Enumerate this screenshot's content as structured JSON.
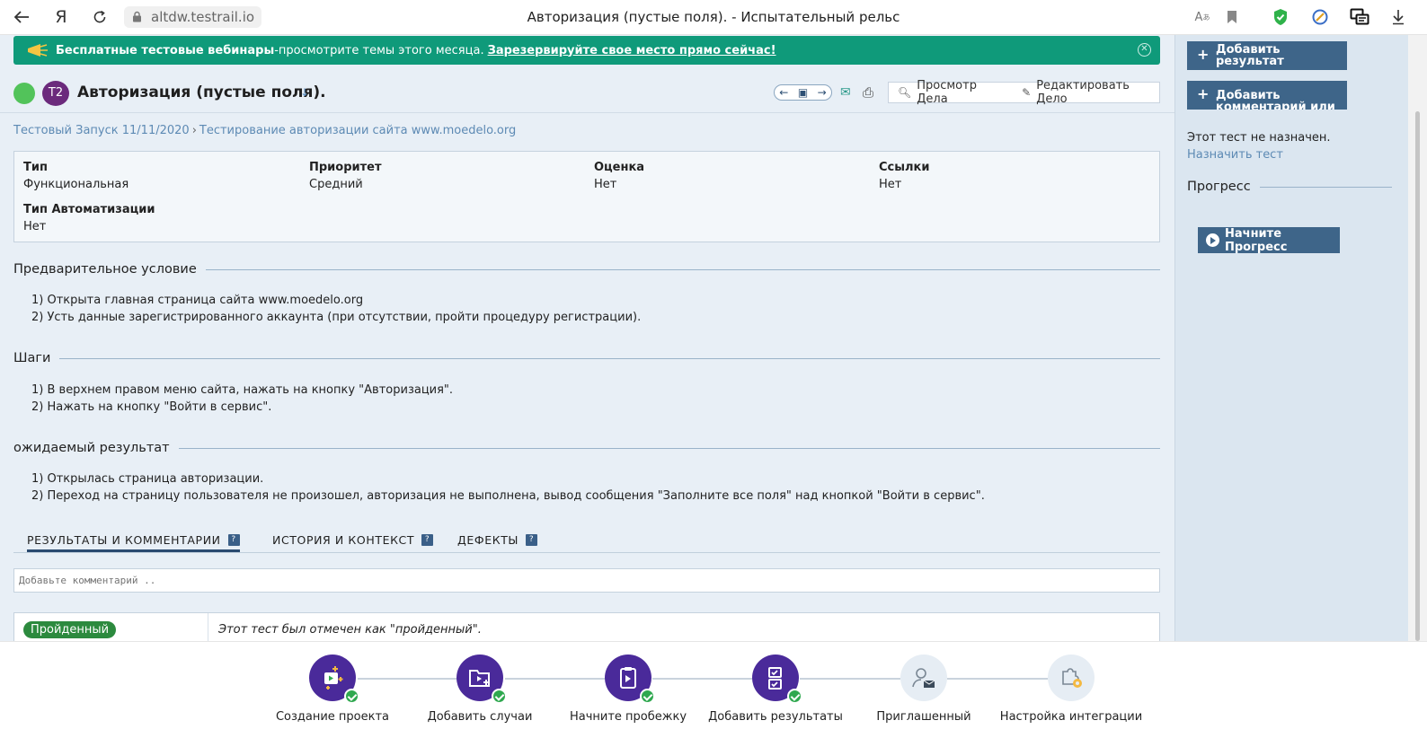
{
  "browser": {
    "url": "altdw.testrail.io",
    "page_title": "Авторизация (пустые поля). - Испытательный рельс"
  },
  "banner": {
    "bold": "Бесплатные тестовые вебинары",
    "text": "-просмотрите темы этого месяца.",
    "link": "Зарезервируйте свое место прямо сейчас!"
  },
  "case": {
    "id": "T2",
    "title": "Авторизация (пустые поля).",
    "view_label": "Просмотр Дела",
    "edit_label": "Редактировать Дело"
  },
  "breadcrumb": {
    "run": "Тестовый Запуск 11/11/2020",
    "suite": "Тестирование авторизации сайта www.moedelo.org"
  },
  "fields": [
    {
      "label": "Тип",
      "value": "Функциональная"
    },
    {
      "label": "Приоритет",
      "value": "Средний"
    },
    {
      "label": "Оценка",
      "value": "Нет"
    },
    {
      "label": "Ссылки",
      "value": "Нет"
    },
    {
      "label": "Тип Автоматизации",
      "value": "Нет"
    }
  ],
  "sections": {
    "precondition": {
      "title": "Предварительное условие",
      "lines": [
        "1) Открыта главная страница сайта www.moedelo.org",
        "2) Усть данные зарегистрированного аккаунта (при отсутствии, пройти процедуру регистрации)."
      ]
    },
    "steps": {
      "title": "Шаги",
      "lines": [
        "1) В верхнем правом меню сайта, нажать на кнопку \"Авторизация\".",
        "2) Нажать на кнопку \"Войти в сервис\"."
      ]
    },
    "expected": {
      "title": "ожидаемый результат",
      "lines": [
        "1) Открылась страница авторизации.",
        "2) Переход на страницу пользователя не произошел, авторизация не выполнена, вывод сообщения \"Заполните все поля\" над кнопкой \"Войти в сервис\"."
      ]
    }
  },
  "tabs": [
    "РЕЗУЛЬТАТЫ И КОММЕНТАРИИ",
    "ИСТОРИЯ И КОНТЕКСТ",
    "ДЕФЕКТЫ"
  ],
  "comment": {
    "placeholder": "Добавьте комментарий .."
  },
  "result": {
    "badge": "Пройденный",
    "text": "Этот тест был отмечен как \"пройденный\"."
  },
  "sidebar": {
    "add_result": "Добавить результат",
    "add_comment": "Добавить комментарий или файл",
    "not_assigned": "Этот тест не назначен.",
    "assign_link": "Назначить тест",
    "progress_title": "Прогресс",
    "start_progress": "Начните Прогресс"
  },
  "onboarding": [
    {
      "label": "Создание проекта",
      "done": true
    },
    {
      "label": "Добавить случаи",
      "done": true
    },
    {
      "label": "Начните пробежку",
      "done": true
    },
    {
      "label": "Добавить результаты",
      "done": true
    },
    {
      "label": "Приглашенный пользователь",
      "done": false
    },
    {
      "label": "Настройка интеграции",
      "done": false
    }
  ],
  "colors": {
    "banner": "#0f9a7a",
    "status": "#52c35a",
    "case_badge": "#6b2a7c",
    "button": "#3e6589",
    "onboarding": "#4a2a9a",
    "success": "#2fa84f"
  }
}
